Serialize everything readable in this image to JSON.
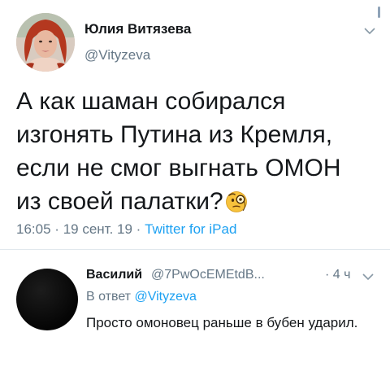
{
  "tweet": {
    "author_name": "Юлия Витязева",
    "author_handle": "@Vityzeva",
    "text_lines": [
      "А как шаман собирался",
      "изгонять Путина из Кремля,",
      "если не смог выгнать ОМОН",
      "из своей палатки?"
    ],
    "emoji": "face-with-monocle-icon",
    "time": "16:05",
    "date": "19 сент. 19",
    "separator": "·",
    "source": "Twitter for iPad"
  },
  "reply": {
    "author_name": "Василий",
    "author_handle": "@7PwOcEMEtdB...",
    "time": "· 4 ч",
    "reply_to_label": "В ответ",
    "reply_to_handle": "@Vityzeva",
    "text": "Просто омоновец раньше в бубен ударил."
  },
  "colors": {
    "text": "#14171a",
    "secondary": "#657786",
    "link": "#1da1f2",
    "divider": "#e1e8ed"
  }
}
